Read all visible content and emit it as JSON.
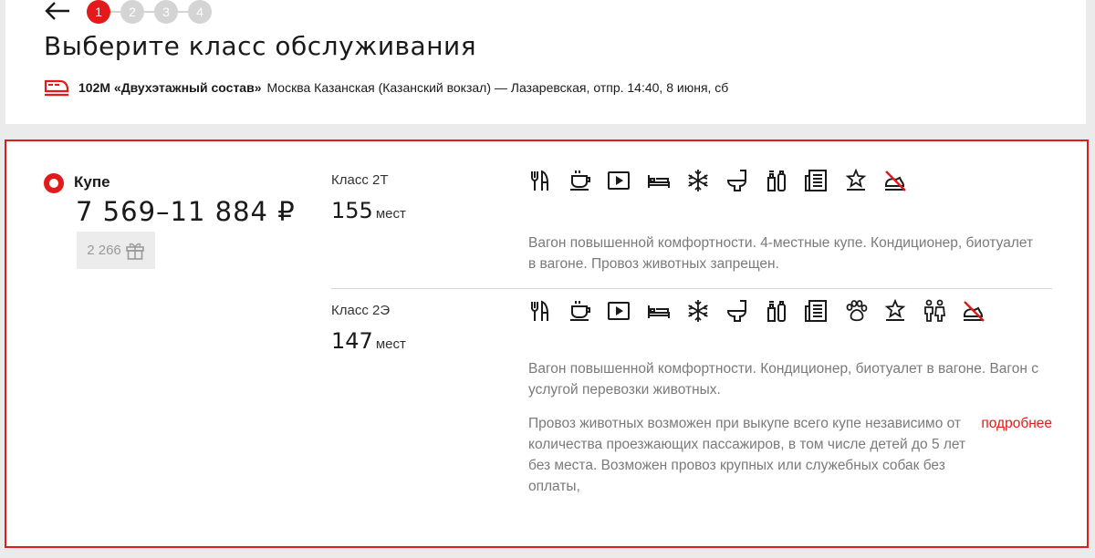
{
  "header": {
    "steps": [
      "1",
      "2",
      "3",
      "4"
    ],
    "title": "Выберите класс обслуживания",
    "train_name": "102М «Двухэтажный состав»",
    "route": "Москва Казанская (Казанский вокзал) — Лазаревская,",
    "departure": "отпр. 14:40, 8 июня, сб"
  },
  "service": {
    "name": "Купе",
    "price": "7 569–11 884 ₽",
    "bonus": "2 266",
    "cars": [
      {
        "label": "Класс 2Т",
        "seats": "155",
        "seats_word": "мест",
        "icons": [
          "cutlery-icon",
          "coffee-icon",
          "video-icon",
          "bed-icon",
          "snowflake-ac-icon",
          "toilet-icon",
          "hygiene-kit-icon",
          "press-icon",
          "star-service-icon",
          "no-pets-icon"
        ],
        "description": "Вагон повышенной комфортности. 4-местные купе. Кондиционер, биотуалет в вагоне. Провоз животных запрещен."
      },
      {
        "label": "Класс 2Э",
        "seats": "147",
        "seats_word": "мест",
        "icons": [
          "cutlery-icon",
          "coffee-icon",
          "video-icon",
          "bed-icon",
          "snowflake-ac-icon",
          "toilet-icon",
          "hygiene-kit-icon",
          "press-icon",
          "paw-pets-icon",
          "star-service-icon",
          "family-icon",
          "no-pets-icon"
        ],
        "description": "Вагон повышенной комфортности. Кондиционер, биотуалет в вагоне. Вагон с услугой перевозки животных.",
        "pets_text": "Провоз животных возможен при выкупе всего купе независимо от количества проезжающих пассажиров, в том числе детей до 5 лет без места. Возможен провоз крупных или служебных собак без оплаты,",
        "more_link": "подробнее"
      }
    ]
  },
  "colors": {
    "accent": "#e21a1a",
    "muted": "#7a7a7a",
    "background": "#ebebeb"
  }
}
